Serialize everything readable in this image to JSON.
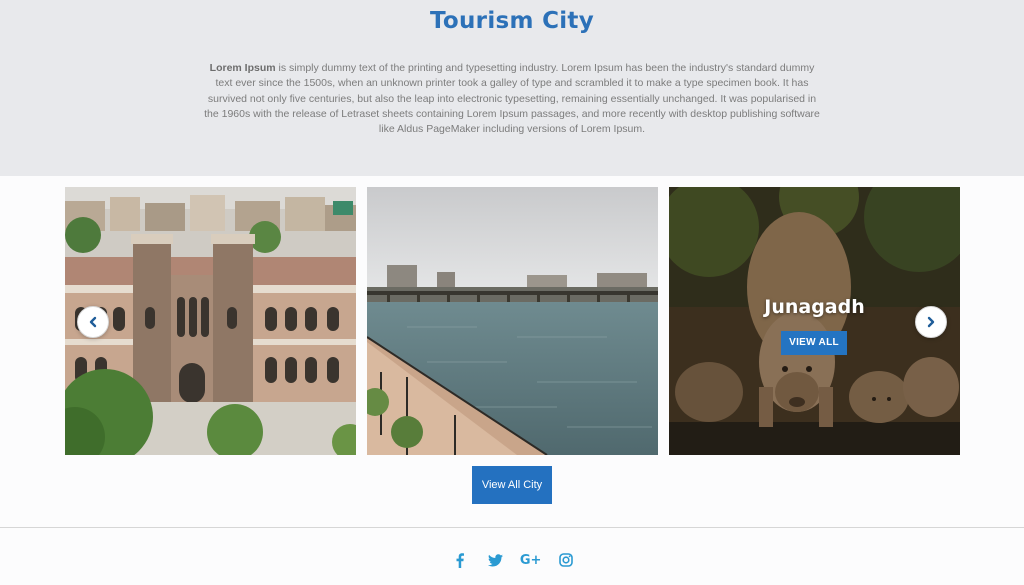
{
  "header": {
    "title": "Tourism City",
    "intro_bold": "Lorem Ipsum",
    "intro_text": " is simply dummy text of the printing and typesetting industry. Lorem Ipsum has been the industry's standard dummy text ever since the 1500s, when an unknown printer took a galley of type and scrambled it to make a type specimen book. It has survived not only five centuries, but also the leap into electronic typesetting, remaining essentially unchanged. It was popularised in the 1960s with the release of Letraset sheets containing Lorem Ipsum passages, and more recently with desktop publishing software like Aldus PageMaker including versions of Lorem Ipsum."
  },
  "carousel": {
    "slides": [
      {
        "image": "heritage-building"
      },
      {
        "image": "riverfront"
      },
      {
        "image": "lions",
        "title": "Junagadh",
        "button_label": "VIEW ALL"
      }
    ],
    "prev_icon": "chevron-left-icon",
    "next_icon": "chevron-right-icon"
  },
  "view_all_button": "View All City",
  "social": {
    "items": [
      {
        "name": "facebook-icon"
      },
      {
        "name": "twitter-icon"
      },
      {
        "name": "google-plus-icon",
        "label": "G+"
      },
      {
        "name": "instagram-icon"
      }
    ]
  },
  "colors": {
    "accent": "#2c71b8",
    "button": "#2471c0",
    "social": "#2a9ad2",
    "header_bg": "#e8e9ec"
  }
}
